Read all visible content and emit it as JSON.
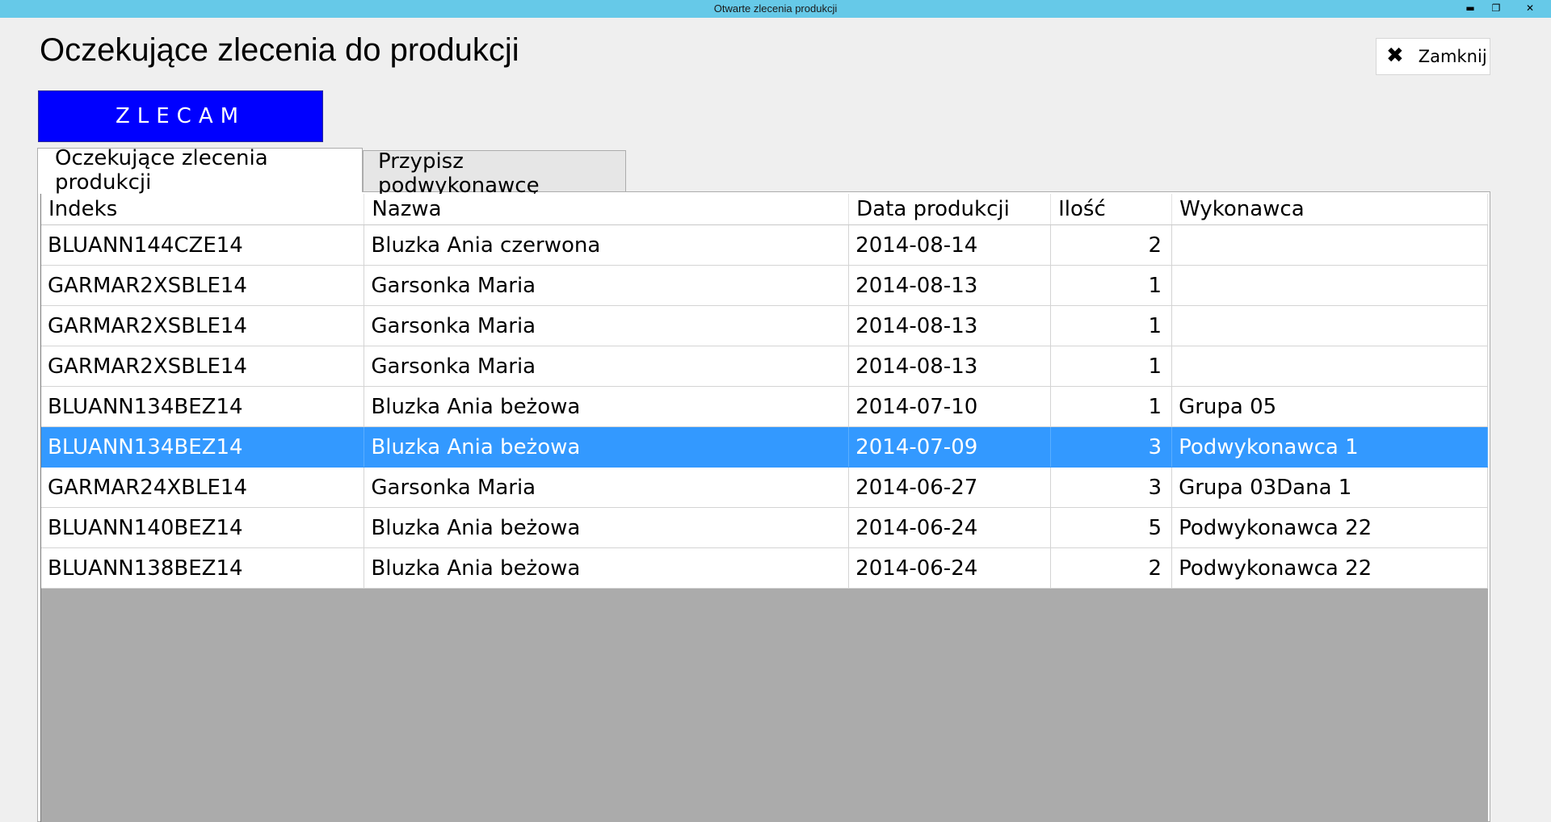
{
  "window": {
    "title": "Otwarte zlecenia produkcji",
    "minimize_glyph": "▬",
    "restore_glyph": "❐",
    "close_glyph": "✕"
  },
  "page": {
    "title": "Oczekujące zlecenia do produkcji",
    "close_label": "Zamknij",
    "close_icon": "close-icon",
    "primary_button": "ZLECAM"
  },
  "tabs": [
    {
      "label": "Oczekujące zlecenia produkcji",
      "selected": true
    },
    {
      "label": "Przypisz podwykonawcę",
      "selected": false
    }
  ],
  "grid": {
    "columns": [
      "Indeks",
      "Nazwa",
      "Data produkcji",
      "Ilość",
      "Wykonawca"
    ],
    "selected_row": 5,
    "rows": [
      {
        "indeks": "BLUANN144CZE14",
        "nazwa": "Bluzka Ania czerwona",
        "data": "2014-08-14",
        "ilosc": "2",
        "wykonawca": ""
      },
      {
        "indeks": "GARMAR2XSBLE14",
        "nazwa": "Garsonka Maria",
        "data": "2014-08-13",
        "ilosc": "1",
        "wykonawca": ""
      },
      {
        "indeks": "GARMAR2XSBLE14",
        "nazwa": "Garsonka Maria",
        "data": "2014-08-13",
        "ilosc": "1",
        "wykonawca": ""
      },
      {
        "indeks": "GARMAR2XSBLE14",
        "nazwa": "Garsonka Maria",
        "data": "2014-08-13",
        "ilosc": "1",
        "wykonawca": ""
      },
      {
        "indeks": "BLUANN134BEZ14",
        "nazwa": "Bluzka Ania beżowa",
        "data": "2014-07-10",
        "ilosc": "1",
        "wykonawca": "Grupa 05"
      },
      {
        "indeks": "BLUANN134BEZ14",
        "nazwa": "Bluzka Ania beżowa",
        "data": "2014-07-09",
        "ilosc": "3",
        "wykonawca": "Podwykonawca 1"
      },
      {
        "indeks": "GARMAR24XBLE14",
        "nazwa": "Garsonka Maria",
        "data": "2014-06-27",
        "ilosc": "3",
        "wykonawca": "Grupa 03Dana 1"
      },
      {
        "indeks": "BLUANN140BEZ14",
        "nazwa": "Bluzka Ania beżowa",
        "data": "2014-06-24",
        "ilosc": "5",
        "wykonawca": "Podwykonawca 22"
      },
      {
        "indeks": "BLUANN138BEZ14",
        "nazwa": "Bluzka Ania beżowa",
        "data": "2014-06-24",
        "ilosc": "2",
        "wykonawca": "Podwykonawca 22"
      }
    ]
  },
  "colors": {
    "titlebar": "#66c9e8",
    "primary_button": "#0000ff",
    "selection": "#3399ff",
    "grid_background": "#ababab"
  }
}
